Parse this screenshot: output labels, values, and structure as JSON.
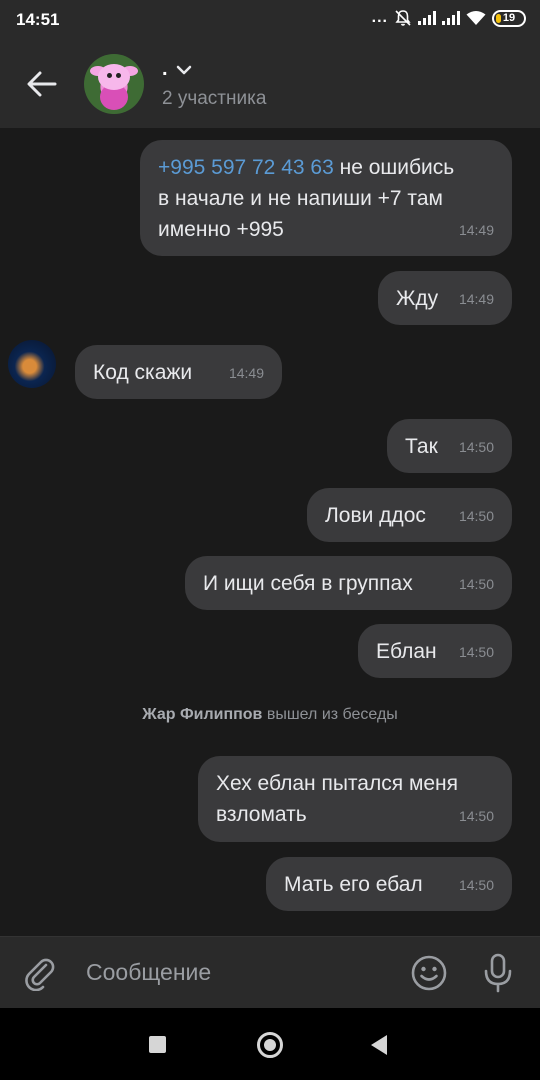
{
  "status_bar": {
    "time": "14:51",
    "dots": "...",
    "battery": "19"
  },
  "header": {
    "title": ".",
    "subtitle": "2 участника"
  },
  "messages": [
    {
      "dir": "out",
      "link": "+995 597 72 43 63",
      "text_line1": " не ошибись",
      "text_line2": "в начале и не напиши +7 там",
      "text_line3": "именно +995",
      "time": "14:49"
    },
    {
      "dir": "out",
      "text": "Жду",
      "time": "14:49"
    },
    {
      "dir": "in",
      "text": "Код скажи",
      "time": "14:49"
    },
    {
      "dir": "out",
      "text": "Так",
      "time": "14:50"
    },
    {
      "dir": "out",
      "text": "Лови ддос",
      "time": "14:50"
    },
    {
      "dir": "out",
      "text": "И ищи себя в группах",
      "time": "14:50"
    },
    {
      "dir": "out",
      "text": "Еблан",
      "time": "14:50"
    },
    {
      "dir": "out",
      "text_line1": "Хех еблан пытался меня",
      "text_line2": "взломать",
      "time": "14:50"
    },
    {
      "dir": "out",
      "text": "Мать его ебал",
      "time": "14:50"
    }
  ],
  "system_message": {
    "name": "Жар Филиппов",
    "text": " вышел из беседы"
  },
  "composer": {
    "placeholder": "Сообщение"
  },
  "icons": {
    "back": "arrow-left-icon",
    "chevron": "chevron-down-icon",
    "attach": "paperclip-icon",
    "emoji": "smiley-icon",
    "mic": "microphone-icon"
  },
  "colors": {
    "background": "#1a1a1a",
    "bubble": "#3a3a3c",
    "link": "#5b9bd5",
    "header": "#2a2a2a"
  }
}
